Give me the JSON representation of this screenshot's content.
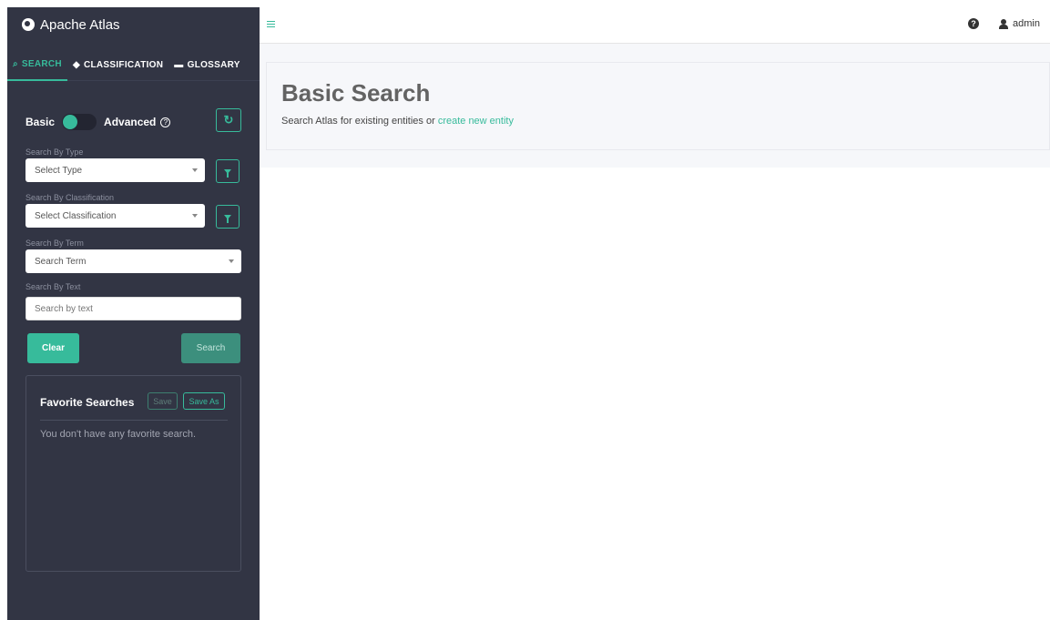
{
  "app": {
    "title": "Apache Atlas"
  },
  "tabs": [
    {
      "label": "SEARCH",
      "icon": "search-icon"
    },
    {
      "label": "CLASSIFICATION",
      "icon": "tag-icon"
    },
    {
      "label": "GLOSSARY",
      "icon": "folder-icon"
    }
  ],
  "search_mode": {
    "basic_label": "Basic",
    "advanced_label": "Advanced"
  },
  "filters": {
    "type_label": "Search By Type",
    "type_placeholder": "Select Type",
    "classification_label": "Search By Classification",
    "classification_placeholder": "Select Classification",
    "term_label": "Search By Term",
    "term_placeholder": "Search Term",
    "text_label": "Search By Text",
    "text_placeholder": "Search by text"
  },
  "actions": {
    "clear_label": "Clear",
    "search_label": "Search"
  },
  "favorites": {
    "title": "Favorite Searches",
    "save_label": "Save",
    "save_as_label": "Save As",
    "empty_text": "You don't have any favorite search."
  },
  "header": {
    "user": "admin"
  },
  "main": {
    "title": "Basic Search",
    "subtitle_prefix": "Search Atlas for existing entities or ",
    "subtitle_link": "create new entity"
  },
  "colors": {
    "accent": "#37bb9b",
    "sidebar_bg": "#323544"
  }
}
